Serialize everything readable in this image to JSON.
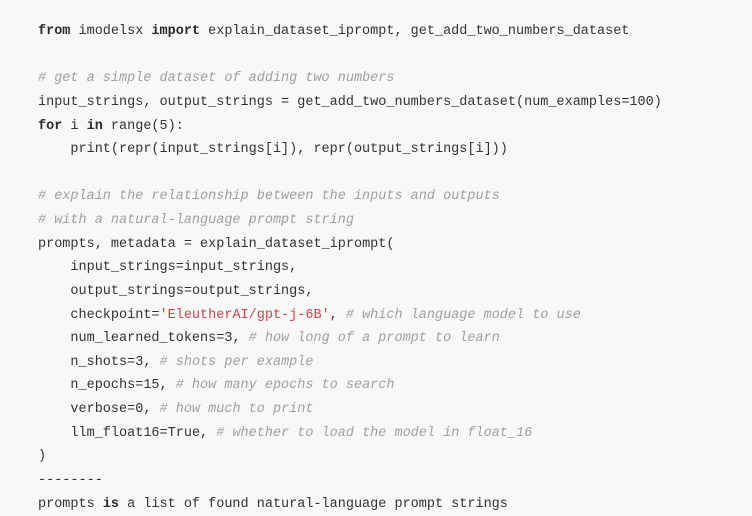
{
  "code": {
    "line1_from": "from",
    "line1_mod": " imodelsx ",
    "line1_import": "import",
    "line1_names": " explain_dataset_iprompt, get_add_two_numbers_dataset",
    "line2_comment": "# get a simple dataset of adding two numbers",
    "line3_a": "input_strings, output_strings ",
    "line3_eq": "=",
    "line3_b": " get_add_two_numbers_dataset(num_examples",
    "line3_eq2": "=",
    "line3_num": "100",
    "line3_c": ")",
    "line4_for": "for",
    "line4_a": " i ",
    "line4_in": "in",
    "line4_b": " range(",
    "line4_num": "5",
    "line4_c": "):",
    "line5": "    print(repr(input_strings[i]), repr(output_strings[i]))",
    "line6_comment": "# explain the relationship between the inputs and outputs",
    "line7_comment": "# with a natural-language prompt string",
    "line8_a": "prompts, metadata ",
    "line8_eq": "=",
    "line8_b": " explain_dataset_iprompt(",
    "line9_a": "    input_strings",
    "line9_eq": "=",
    "line9_b": "input_strings,",
    "line10_a": "    output_strings",
    "line10_eq": "=",
    "line10_b": "output_strings,",
    "line11_a": "    checkpoint",
    "line11_eq": "=",
    "line11_str": "'EleutherAI/gpt-j-6B'",
    "line11_c": ", ",
    "line11_comment": "# which language model to use",
    "line12_a": "    num_learned_tokens",
    "line12_eq": "=",
    "line12_num": "3",
    "line12_c": ", ",
    "line12_comment": "# how long of a prompt to learn",
    "line13_a": "    n_shots",
    "line13_eq": "=",
    "line13_num": "3",
    "line13_c": ", ",
    "line13_comment": "# shots per example",
    "line14_a": "    n_epochs",
    "line14_eq": "=",
    "line14_num": "15",
    "line14_c": ", ",
    "line14_comment": "# how many epochs to search",
    "line15_a": "    verbose",
    "line15_eq": "=",
    "line15_num": "0",
    "line15_c": ", ",
    "line15_comment": "# how much to print",
    "line16_a": "    llm_float16",
    "line16_eq": "=",
    "line16_val": "True",
    "line16_c": ", ",
    "line16_comment": "# whether to load the model in float_16",
    "line17": ")",
    "line18": "--------",
    "line19_a": "prompts ",
    "line19_is": "is",
    "line19_b": " a list of found natural-language prompt strings"
  }
}
